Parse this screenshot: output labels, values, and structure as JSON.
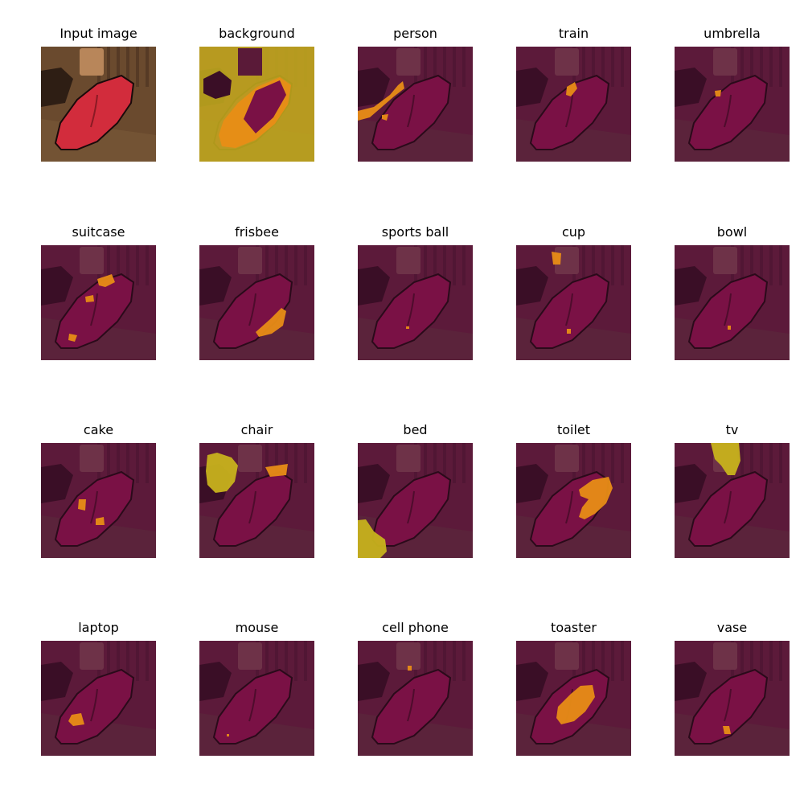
{
  "figure": {
    "panels": [
      {
        "title": "Input image",
        "kind": "input"
      },
      {
        "title": "background",
        "kind": "background"
      },
      {
        "title": "person",
        "kind": "mask",
        "regions": [
          [
            "M 0 80 L 20 75 L 40 60 L 50 48 L 56 43 L 58 52 L 45 62 L 30 75 L 15 88 L 0 92 Z",
            "M 30 85 L 38 84 L 36 92 L 30 90 Z"
          ]
        ]
      },
      {
        "title": "train",
        "kind": "mask",
        "regions": [
          [
            "M 63 50 L 73 44 L 76 52 L 68 62 L 62 60 Z"
          ]
        ]
      },
      {
        "title": "umbrella",
        "kind": "mask",
        "regions": [
          [
            "M 50 55 L 58 54 L 57 62 L 51 62 Z"
          ]
        ]
      },
      {
        "title": "suitcase",
        "kind": "mask",
        "regions": [
          [
            "M 70 42 L 88 36 L 92 46 L 80 52 L 72 50 Z",
            "M 55 64 L 65 62 L 66 70 L 56 71 Z",
            "M 35 110 L 45 112 L 42 120 L 34 118 Z"
          ]
        ]
      },
      {
        "title": "frisbee",
        "kind": "mask",
        "regions": [
          [
            "M 70 108 L 88 92 L 102 78 L 108 82 L 104 100 L 90 110 L 74 114 Z"
          ]
        ]
      },
      {
        "title": "sports ball",
        "kind": "mask",
        "regions": [
          [
            "M 60 101 L 64 101 L 64 104 L 60 104 Z"
          ]
        ]
      },
      {
        "title": "cup",
        "kind": "mask",
        "regions": [
          [
            "M 44 8 L 56 10 L 55 24 L 46 24 Z",
            "M 63 104 L 68 104 L 68 110 L 63 110 Z"
          ]
        ]
      },
      {
        "title": "bowl",
        "kind": "mask",
        "regions": [
          [
            "M 66 100 L 70 100 L 70 105 L 66 105 Z"
          ]
        ]
      },
      {
        "title": "cake",
        "kind": "mask",
        "regions": [
          [
            "M 47 70 L 56 70 L 55 84 L 46 82 Z",
            "M 68 94 L 78 92 L 79 102 L 68 102 Z"
          ]
        ]
      },
      {
        "title": "chair",
        "kind": "mask",
        "regions": [
          [
            "M 10 15 L 22 12 L 40 18 L 48 28 L 44 48 L 34 60 L 20 62 L 10 52 L 8 35 Z",
            "M 82 30 L 110 26 L 108 40 L 88 42 Z"
          ]
        ]
      },
      {
        "title": "bed",
        "kind": "mask",
        "regions": [
          [
            "M 0 96 L 10 95 L 20 110 L 34 120 L 36 135 L 28 143 L 0 143 Z"
          ]
        ]
      },
      {
        "title": "toilet",
        "kind": "mask",
        "regions": [
          [
            "M 78 58 L 95 46 L 115 42 L 120 56 L 112 75 L 98 88 L 85 95 L 78 92 L 82 80 L 90 70 L 80 66 Z"
          ]
        ]
      },
      {
        "title": "tv",
        "kind": "mask",
        "regions": [
          [
            "M 45 0 L 80 0 L 82 22 L 75 40 L 66 40 L 58 28 L 50 20 Z"
          ]
        ]
      },
      {
        "title": "laptop",
        "kind": "mask",
        "regions": [
          [
            "M 38 92 L 50 90 L 54 104 L 40 106 L 34 100 Z"
          ]
        ]
      },
      {
        "title": "mouse",
        "kind": "mask",
        "regions": [
          [
            "M 34 116 L 37 116 L 37 119 L 34 119 Z"
          ]
        ]
      },
      {
        "title": "cell phone",
        "kind": "mask",
        "regions": [
          [
            "M 62 31 L 67 31 L 67 37 L 62 37 Z"
          ]
        ]
      },
      {
        "title": "toaster",
        "kind": "mask",
        "regions": [
          [
            "M 52 82 L 68 66 L 80 56 L 95 55 L 98 70 L 86 88 L 72 100 L 56 104 L 50 96 Z"
          ]
        ]
      },
      {
        "title": "vase",
        "kind": "mask",
        "regions": [
          [
            "M 60 106 L 68 106 L 70 116 L 62 116 Z"
          ]
        ]
      }
    ]
  },
  "colors": {
    "input_bg": "#6a4a2e",
    "couch": "#d22c3c",
    "overlay_dark": "#5c1a3a",
    "overlay_couch": "#7a1145",
    "mask_fill": "#e88d16",
    "mask_fill_yellow": "#c7b21c"
  }
}
